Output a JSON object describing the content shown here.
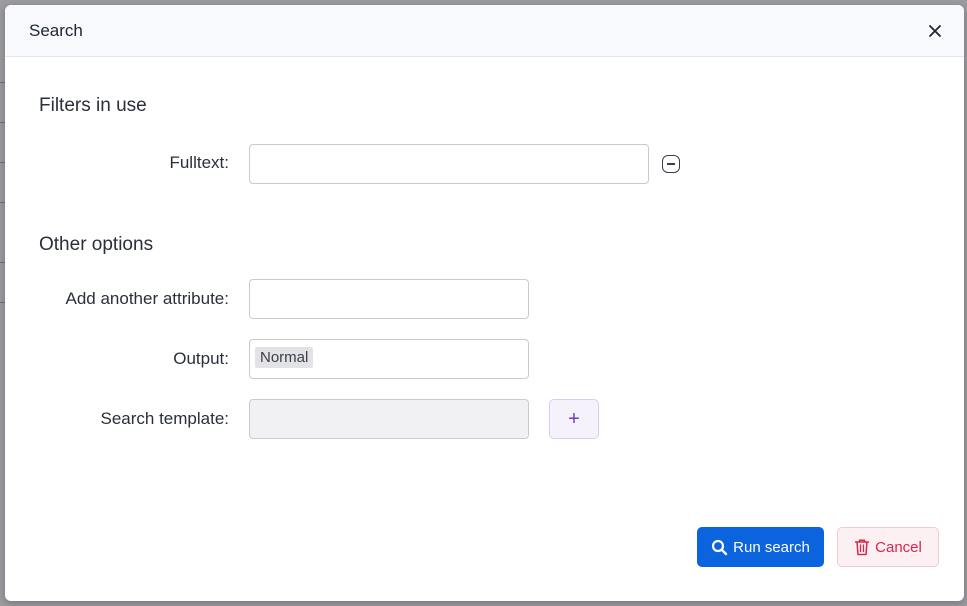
{
  "modal": {
    "title": "Search",
    "close_icon": "close-icon"
  },
  "sections": {
    "filters_in_use": "Filters in use",
    "other_options": "Other options"
  },
  "fields": {
    "fulltext": {
      "label": "Fulltext:",
      "value": "",
      "placeholder": ""
    },
    "add_attribute": {
      "label": "Add another attribute:",
      "value": ""
    },
    "output": {
      "label": "Output:",
      "selected": "Normal"
    },
    "search_template": {
      "label": "Search template:",
      "value": "",
      "add_label": "+"
    }
  },
  "actions": {
    "run_search": "Run search",
    "cancel": "Cancel"
  },
  "colors": {
    "primary": "#0b63de",
    "danger": "#d6264e",
    "accent": "#6a3fbf"
  }
}
